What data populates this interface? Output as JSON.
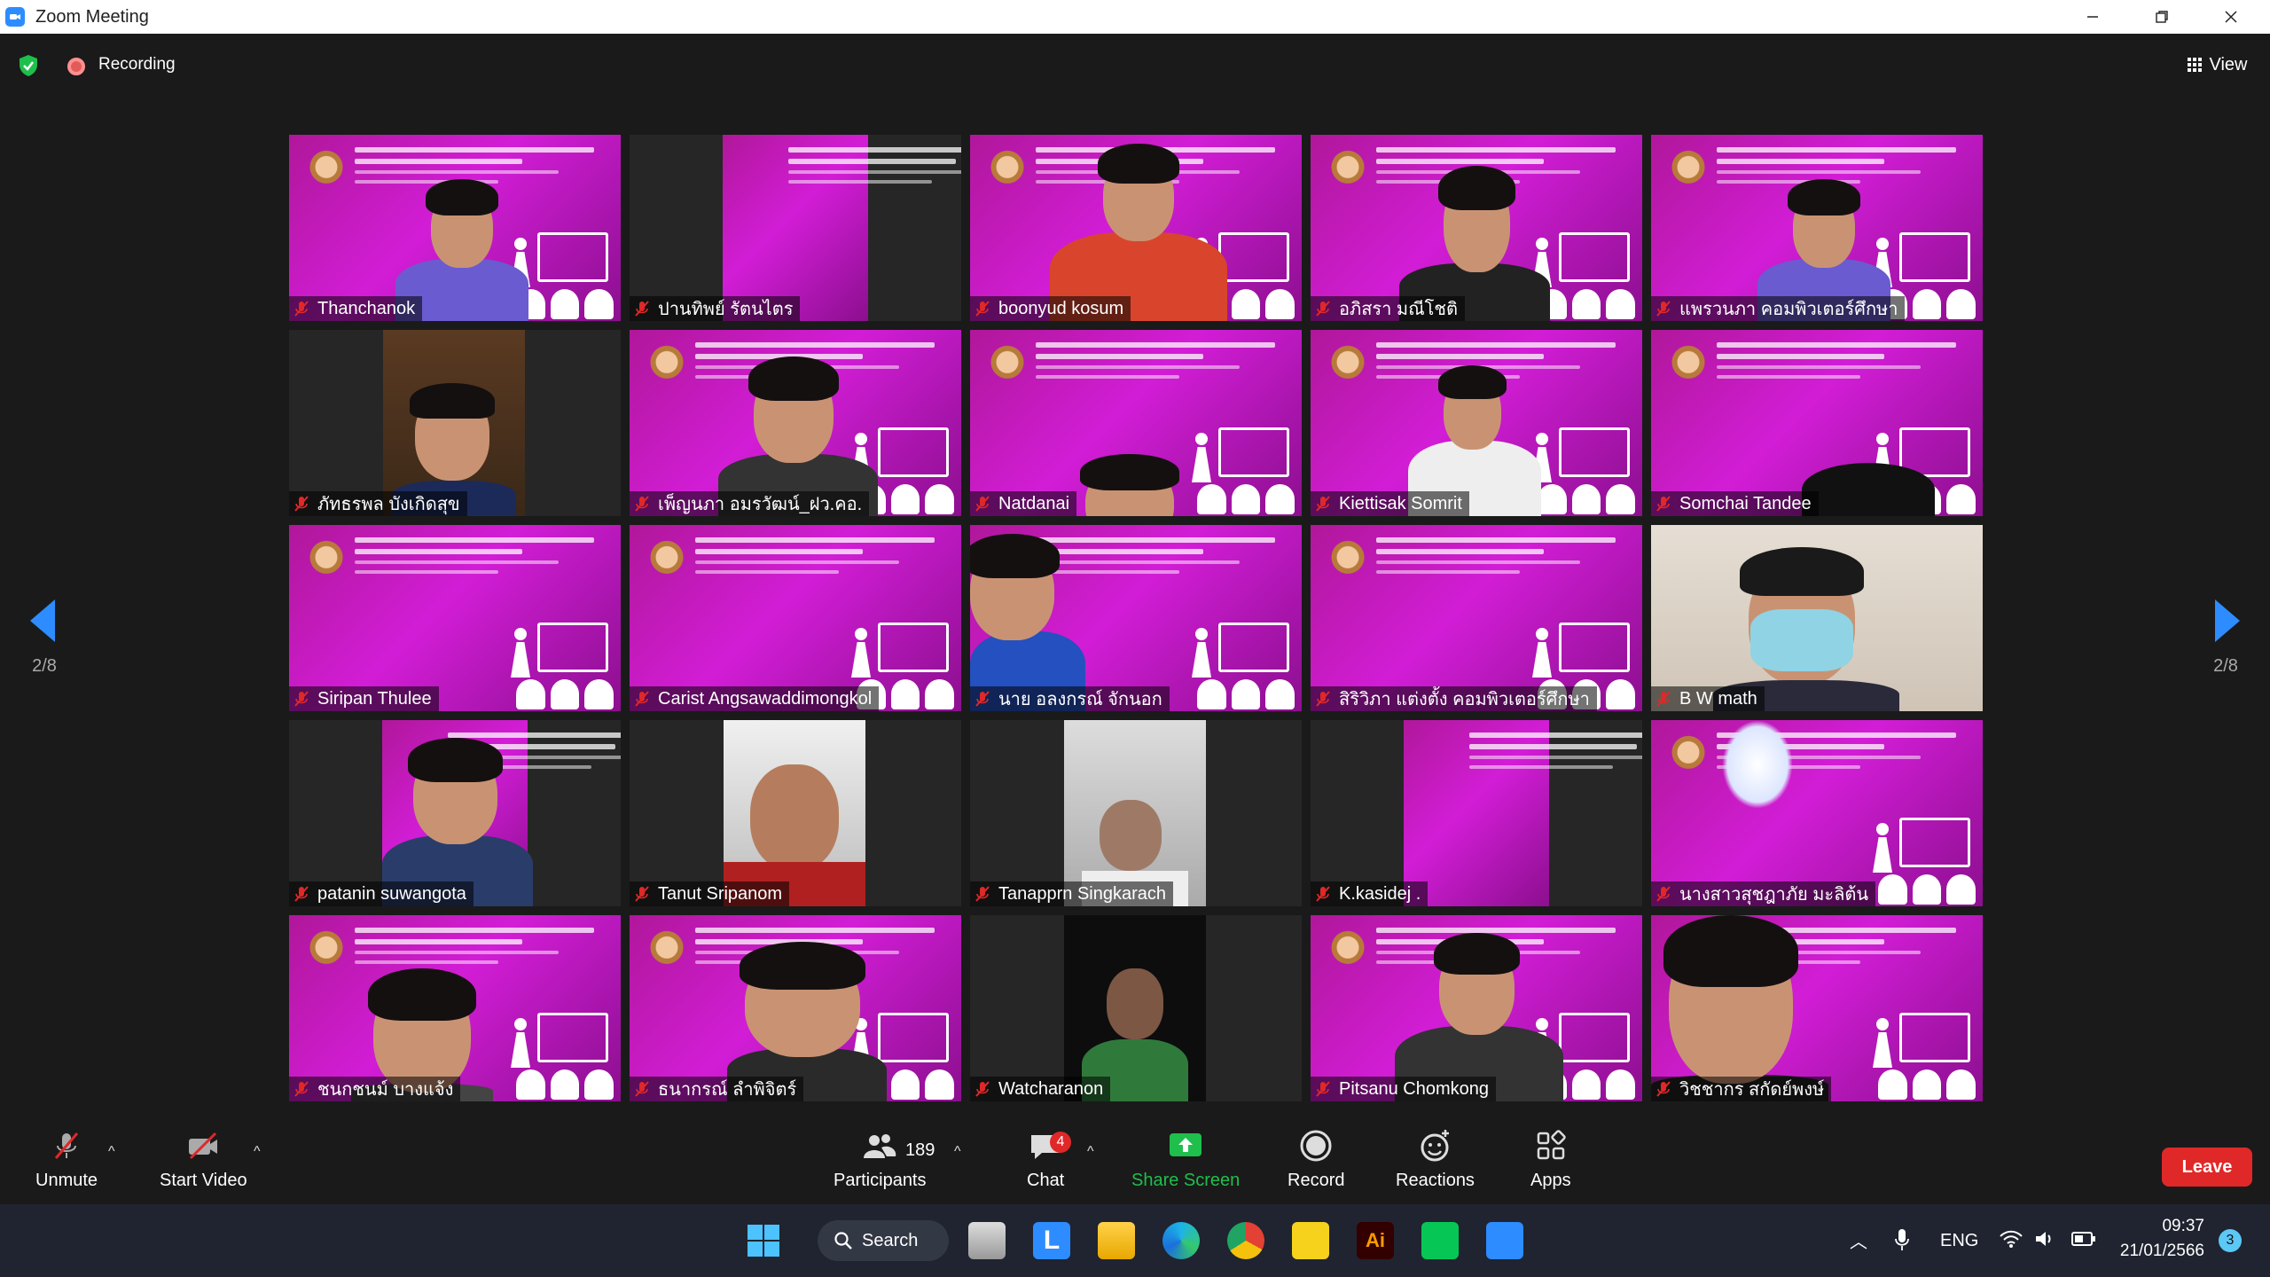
{
  "window": {
    "title": "Zoom Meeting"
  },
  "meeting": {
    "recording_label": "Recording",
    "view_label": "View",
    "page_left": "2/8",
    "page_right": "2/8"
  },
  "participants": [
    {
      "name": "Thanchanok"
    },
    {
      "name": "ปานทิพย์ รัตนไตร"
    },
    {
      "name": "boonyud kosum"
    },
    {
      "name": "อภิสรา มณีโชติ"
    },
    {
      "name": "แพรวนภา คอมพิวเตอร์ศึกษา"
    },
    {
      "name": "ภัทธรพล บังเกิดสุข"
    },
    {
      "name": "เพ็ญนภา  อมรวัฒน์_ฝว.คอ."
    },
    {
      "name": "Natdanai"
    },
    {
      "name": "Kiettisak Somrit"
    },
    {
      "name": "Somchai Tandee"
    },
    {
      "name": "Siripan Thulee"
    },
    {
      "name": "Carist Angsawaddimongkol"
    },
    {
      "name": "นาย อลงกรณ์ จักนอก"
    },
    {
      "name": "สิริวิภา แต่งตั้ง คอมพิวเตอร์ศึกษา"
    },
    {
      "name": "B W math"
    },
    {
      "name": "patanin suwangota"
    },
    {
      "name": "Tanut Sripanom"
    },
    {
      "name": "Tanapprn Singkarach"
    },
    {
      "name": "K.kasidej ."
    },
    {
      "name": "นางสาวสุชฎาภัย มะลิต้น"
    },
    {
      "name": "ชนกชนม์ บางแจ้ง"
    },
    {
      "name": "ธนากรณ์ ลำพิจิตร์"
    },
    {
      "name": "Watcharanon"
    },
    {
      "name": "Pitsanu Chomkong"
    },
    {
      "name": "วิชชากร สกัดย์พงษ์"
    }
  ],
  "toolbar": {
    "unmute": "Unmute",
    "start_video": "Start Video",
    "participants": "Participants",
    "participants_count": "189",
    "chat": "Chat",
    "chat_badge": "4",
    "share_screen": "Share Screen",
    "record": "Record",
    "reactions": "Reactions",
    "apps": "Apps",
    "leave": "Leave"
  },
  "taskbar": {
    "search": "Search",
    "language": "ENG",
    "time": "09:37",
    "date": "21/01/2566",
    "notifications": "3"
  },
  "colors": {
    "accent": "#2d8cff",
    "leave": "#e02828",
    "share": "#1fbf4c",
    "slide": "#c21bc4"
  }
}
